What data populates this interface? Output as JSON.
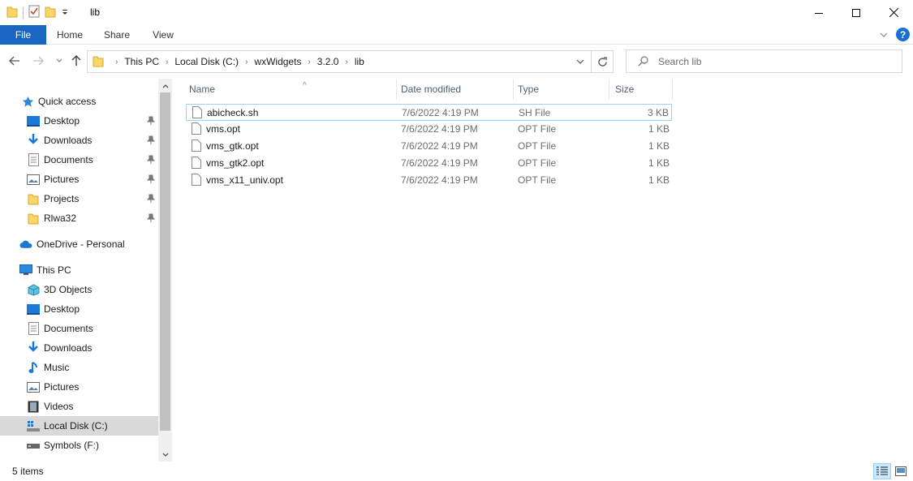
{
  "window": {
    "title": "lib"
  },
  "ribbon": {
    "tabs": [
      "File",
      "Home",
      "Share",
      "View"
    ]
  },
  "address": {
    "crumbs": [
      "This PC",
      "Local Disk (C:)",
      "wxWidgets",
      "3.2.0",
      "lib"
    ]
  },
  "search": {
    "placeholder": "Search lib"
  },
  "sidebar": {
    "quick_access": "Quick access",
    "quick_items": [
      "Desktop",
      "Downloads",
      "Documents",
      "Pictures",
      "Projects",
      "Rlwa32"
    ],
    "onedrive": "OneDrive - Personal",
    "this_pc": "This PC",
    "pc_items": [
      "3D Objects",
      "Desktop",
      "Documents",
      "Downloads",
      "Music",
      "Pictures",
      "Videos",
      "Local Disk (C:)",
      "Symbols (F:)"
    ]
  },
  "columns": {
    "name": "Name",
    "date": "Date modified",
    "type": "Type",
    "size": "Size"
  },
  "files": [
    {
      "name": "abicheck.sh",
      "date": "7/6/2022 4:19 PM",
      "type": "SH File",
      "size": "3 KB"
    },
    {
      "name": "vms.opt",
      "date": "7/6/2022 4:19 PM",
      "type": "OPT File",
      "size": "1 KB"
    },
    {
      "name": "vms_gtk.opt",
      "date": "7/6/2022 4:19 PM",
      "type": "OPT File",
      "size": "1 KB"
    },
    {
      "name": "vms_gtk2.opt",
      "date": "7/6/2022 4:19 PM",
      "type": "OPT File",
      "size": "1 KB"
    },
    {
      "name": "vms_x11_univ.opt",
      "date": "7/6/2022 4:19 PM",
      "type": "OPT File",
      "size": "1 KB"
    }
  ],
  "status": {
    "item_count": "5 items"
  },
  "colors": {
    "file_tab": "#1966c0",
    "folder": "#f8d66a",
    "selection": "#d9d9d9",
    "focus_border": "#99d1ff"
  }
}
